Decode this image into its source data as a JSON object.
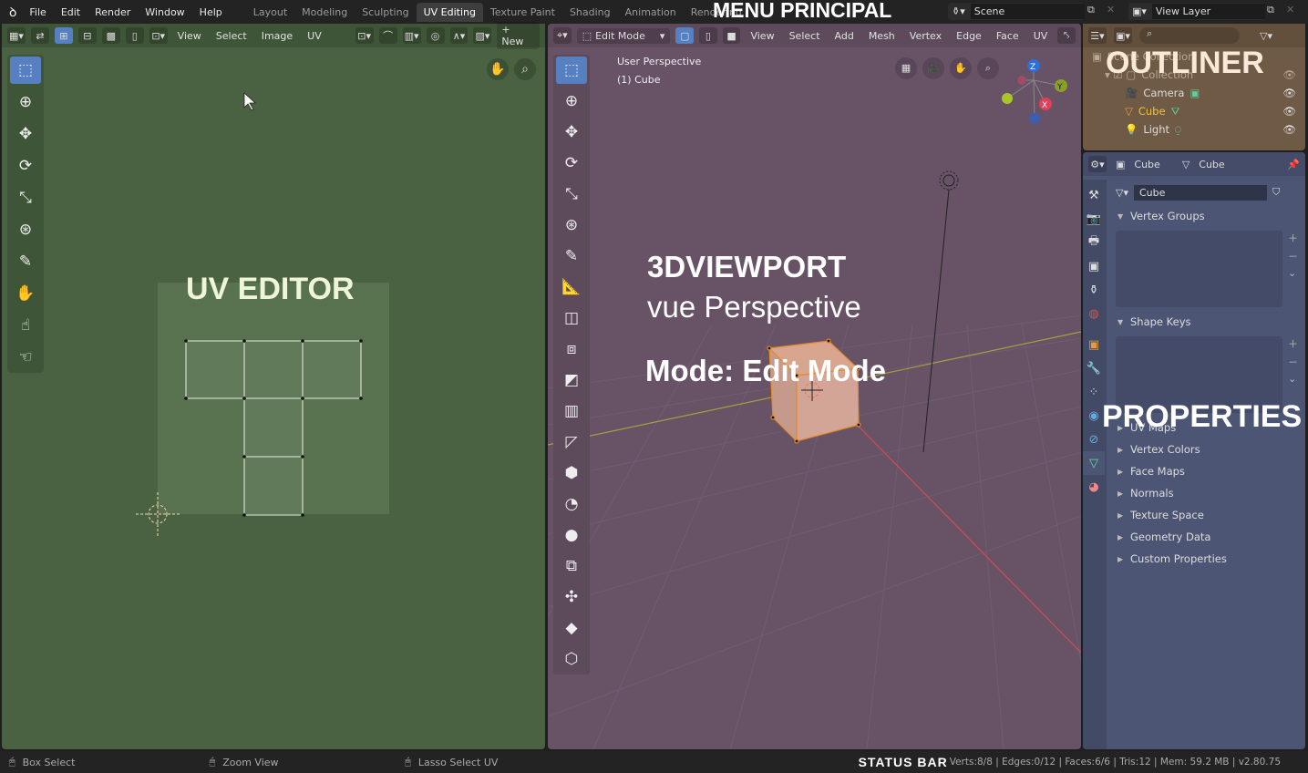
{
  "topbar": {
    "menus": [
      "File",
      "Edit",
      "Render",
      "Window",
      "Help"
    ],
    "workspaces": [
      "Layout",
      "Modeling",
      "Sculpting",
      "UV Editing",
      "Texture Paint",
      "Shading",
      "Animation",
      "Rendering"
    ],
    "active_workspace": "UV Editing",
    "scene": "Scene",
    "view_layer": "View Layer",
    "overlay_label": "MENU PRINCIPAL"
  },
  "uv_editor": {
    "header_menus": [
      "View",
      "Select",
      "Image",
      "UV"
    ],
    "new_label": "New",
    "overlay_label": "UV EDITOR",
    "bg_color": "#4a6241"
  },
  "viewport": {
    "mode": "Edit Mode",
    "header_menus": [
      "View",
      "Select",
      "Add",
      "Mesh",
      "Vertex",
      "Edge",
      "Face",
      "UV"
    ],
    "view_name": "User Perspective",
    "object_name": "(1) Cube",
    "overlay_title": "3DVIEWPORT",
    "overlay_subtitle": "vue Perspective",
    "overlay_mode": "Mode: Edit Mode",
    "bg_color": "#685265"
  },
  "outliner": {
    "overlay_label": "OUTLINER",
    "scene_collection": "Scene Collection",
    "collection": "Collection",
    "items": [
      {
        "name": "Camera",
        "active": false
      },
      {
        "name": "Cube",
        "active": true
      },
      {
        "name": "Light",
        "active": false
      }
    ],
    "bg_color": "#6f5a45"
  },
  "properties": {
    "overlay_label": "PROPERTIES",
    "object_name": "Cube",
    "mesh_name": "Cube",
    "datablock": "Cube",
    "panels_open": [
      "Vertex Groups",
      "Shape Keys"
    ],
    "panels_closed": [
      "UV Maps",
      "Vertex Colors",
      "Face Maps",
      "Normals",
      "Texture Space",
      "Geometry Data",
      "Custom Properties"
    ],
    "bg_color": "#4d5574"
  },
  "statusbar": {
    "hints": [
      "Box Select",
      "Zoom View",
      "Lasso Select UV"
    ],
    "overlay_label": "STATUS BAR",
    "stats": "Verts:8/8 | Edges:0/12 | Faces:6/6 | Tris:12 | Mem: 59.2 MB | v2.80.75"
  }
}
